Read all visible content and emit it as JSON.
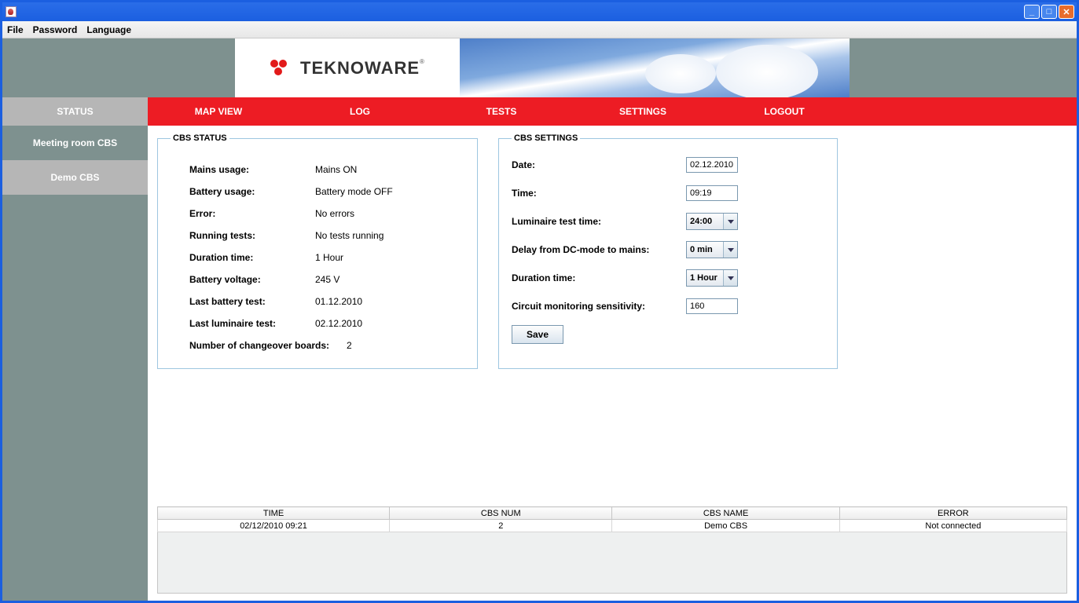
{
  "window": {
    "title": ""
  },
  "menubar": [
    "File",
    "Password",
    "Language"
  ],
  "brand": {
    "name": "TEKNOWARE"
  },
  "tabs": {
    "status": "STATUS",
    "nav": [
      "MAP VIEW",
      "LOG",
      "TESTS",
      "SETTINGS",
      "LOGOUT"
    ]
  },
  "sidebar": {
    "items": [
      {
        "label": "Meeting room CBS",
        "active": false
      },
      {
        "label": "Demo CBS",
        "active": true
      }
    ]
  },
  "status_box": {
    "title": "CBS STATUS",
    "rows": [
      {
        "label": "Mains usage:",
        "value": "Mains ON"
      },
      {
        "label": "Battery usage:",
        "value": "Battery mode OFF"
      },
      {
        "label": "Error:",
        "value": "No errors"
      },
      {
        "label": "Running tests:",
        "value": "No tests running"
      },
      {
        "label": "Duration time:",
        "value": "1 Hour"
      },
      {
        "label": "Battery voltage:",
        "value": "245 V"
      },
      {
        "label": "Last battery test:",
        "value": "01.12.2010"
      },
      {
        "label": "Last luminaire test:",
        "value": "02.12.2010"
      },
      {
        "label": "Number of changeover boards:",
        "value": "2"
      }
    ]
  },
  "settings_box": {
    "title": "CBS SETTINGS",
    "date": {
      "label": "Date:",
      "value": "02.12.2010"
    },
    "time": {
      "label": "Time:",
      "value": "09:19"
    },
    "luminaire": {
      "label": "Luminaire test time:",
      "value": "24:00"
    },
    "delay": {
      "label": "Delay from DC-mode to mains:",
      "value": "0 min"
    },
    "duration": {
      "label": "Duration time:",
      "value": "1 Hour"
    },
    "sensitivity": {
      "label": "Circuit monitoring sensitivity:",
      "value": "160"
    },
    "save": "Save"
  },
  "error_table": {
    "headers": [
      "TIME",
      "CBS NUM",
      "CBS NAME",
      "ERROR"
    ],
    "row": {
      "time": "02/12/2010 09:21",
      "num": "2",
      "name": "Demo CBS",
      "error": "Not connected"
    }
  }
}
